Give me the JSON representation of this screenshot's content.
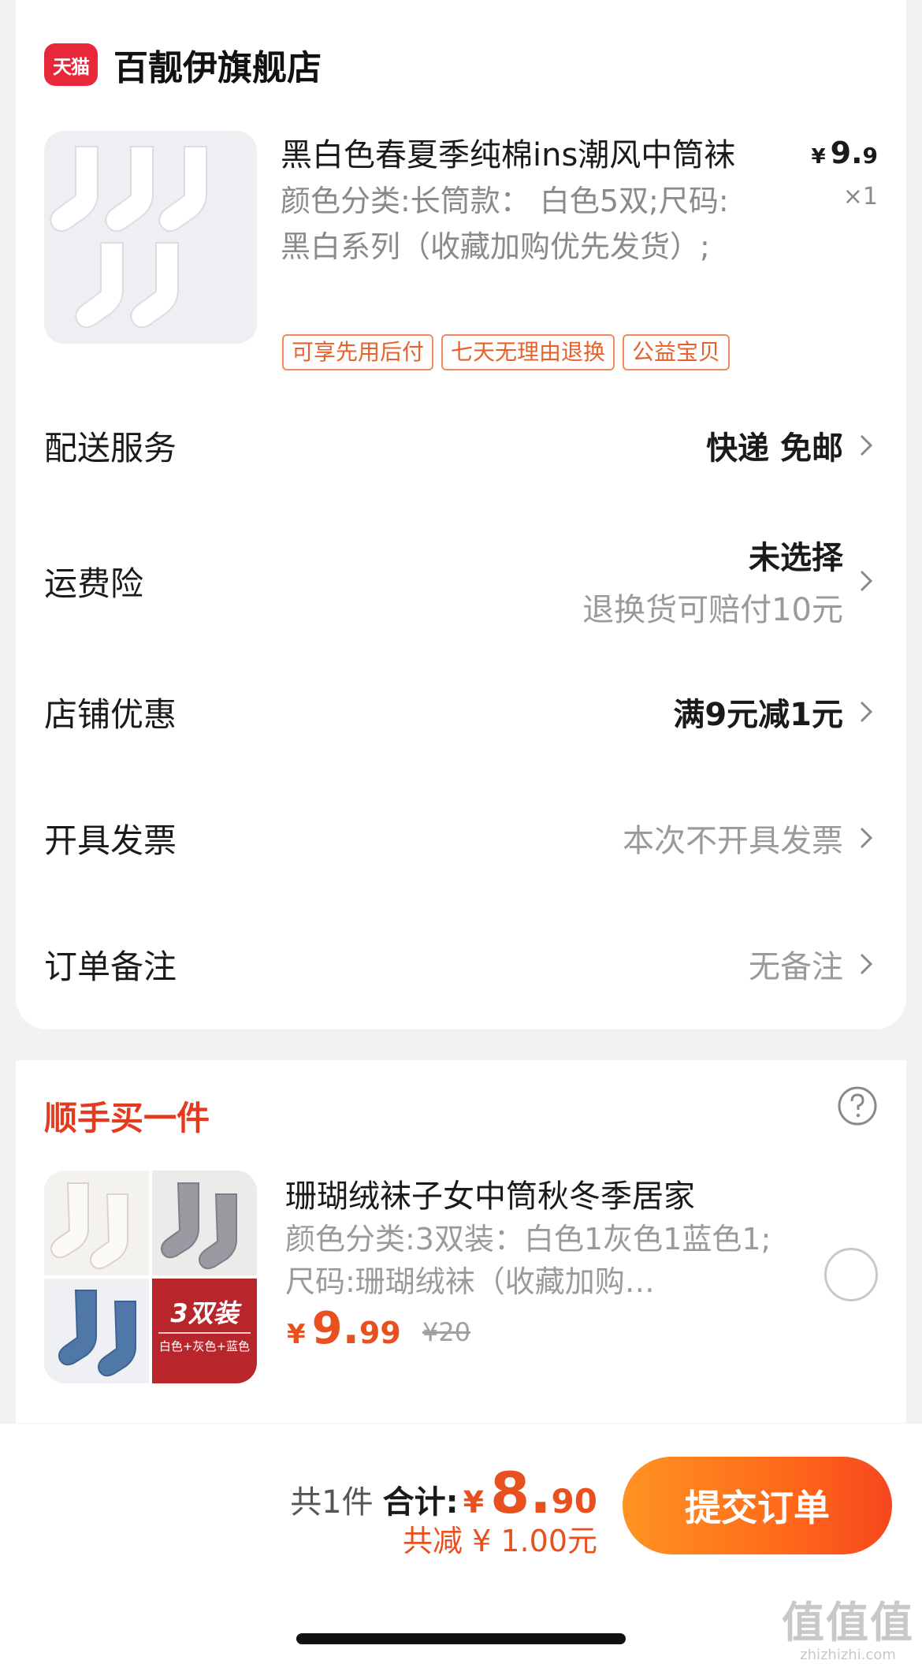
{
  "shop": {
    "logo_text": "天猫",
    "name": "百靓伊旗舰店"
  },
  "product": {
    "title": "黑白色春夏季纯棉ins潮风中筒袜",
    "sku": "颜色分类:长筒款： 白色5双;尺码:黑白系列（收藏加购优先发货）;",
    "price_yen": "¥",
    "price_int": "9.",
    "price_dec": "9",
    "qty": "×1",
    "tags": [
      "可享先用后付",
      "七天无理由退换",
      "公益宝贝"
    ]
  },
  "rows": {
    "delivery": {
      "label": "配送服务",
      "value": "快递 免邮"
    },
    "insurance": {
      "label": "运费险",
      "value": "未选择",
      "sub": "退换货可赔付10元"
    },
    "discount": {
      "label": "店铺优惠",
      "value": "满9元减1元"
    },
    "invoice": {
      "label": "开具发票",
      "value": "本次不开具发票"
    },
    "note": {
      "label": "订单备注",
      "value": "无备注"
    }
  },
  "addon": {
    "section_title": "顺手买一件",
    "name": "珊瑚绒袜子女中筒秋冬季居家",
    "sku": "颜色分类:3双装：白色1灰色1蓝色1;尺码:珊瑚绒袜（收藏加购…",
    "price_yen": "¥",
    "price_int": "9.",
    "price_dec": "99",
    "orig_price": "¥20",
    "badge_big": "3双装",
    "badge_small": "白色+灰色+蓝色"
  },
  "footer": {
    "count": "共1件",
    "total_label": "合计:",
    "total_yen": "¥",
    "total_int": "8.",
    "total_dec": "90",
    "saved": "共减 ¥ 1.00元",
    "submit": "提交订单"
  },
  "watermark": {
    "big": "值值值",
    "small": "zhizhizhi.com"
  },
  "colors": {
    "accent": "#e8511f",
    "tmall_red": "#e8283a",
    "tag_orange": "#e8612d"
  },
  "icons": {
    "chevron": "chevron-right-icon",
    "help": "question-circle-icon",
    "radio": "radio-unchecked-icon"
  }
}
